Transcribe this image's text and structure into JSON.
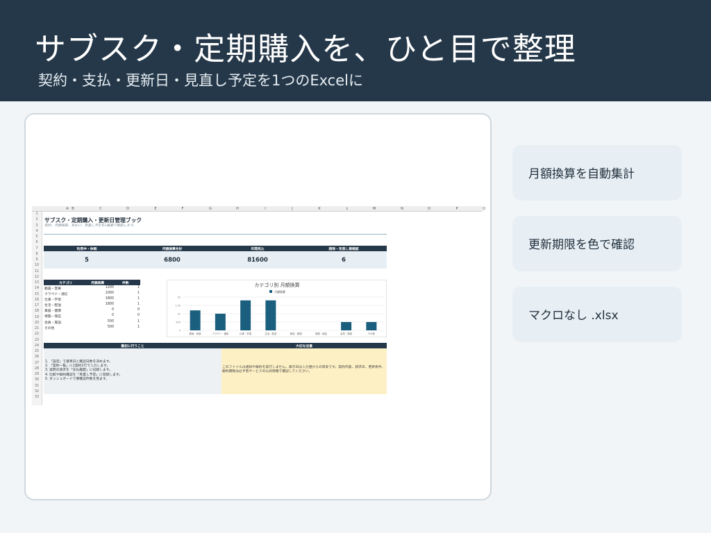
{
  "header": {
    "title": "サブスク・定期購入を、ひと目で整理",
    "subtitle": "契約・支払・更新日・見直し予定を1つのExcelに"
  },
  "sheet": {
    "columns": [
      "A",
      "B",
      "C",
      "D",
      "E",
      "F",
      "G",
      "H",
      "I",
      "J",
      "K",
      "L",
      "M",
      "N",
      "O",
      "P",
      "Q"
    ],
    "rows": [
      "1",
      "2",
      "3",
      "4",
      "5",
      "6",
      "7",
      "8",
      "9",
      "10",
      "11",
      "12",
      "13",
      "14",
      "15",
      "16",
      "17",
      "18",
      "19",
      "20",
      "21",
      "22",
      "23",
      "24",
      "25",
      "26",
      "27",
      "28",
      "29",
      "30",
      "31",
      "32",
      "33"
    ],
    "title": "サブスク・定期購入・更新日管理ブック",
    "subtitle": "契約、月額換算、支払い、見直し予定を1画面で確認します。",
    "kpis": [
      {
        "label": "利用中・休眠",
        "value": "5"
      },
      {
        "label": "月額換算合計",
        "value": "6800"
      },
      {
        "label": "年間見込",
        "value": "81600"
      },
      {
        "label": "期限・見直し要確認",
        "value": "6"
      }
    ],
    "category_table": {
      "headers": [
        "カテゴリ",
        "月額換算",
        "件数"
      ],
      "rows": [
        [
          "動画・音楽",
          "1200",
          "1"
        ],
        [
          "クラウド・通信",
          "1000",
          "1"
        ],
        [
          "仕事・学習",
          "1800",
          "1"
        ],
        [
          "生活・配送",
          "1800",
          "1"
        ],
        [
          "美容・健康",
          "0",
          "0"
        ],
        [
          "保険・保証",
          "0",
          "0"
        ],
        [
          "会員・施設",
          "500",
          "1"
        ],
        [
          "その他",
          "500",
          "1"
        ]
      ]
    },
    "steps": {
      "title": "最初に行うこと",
      "items": [
        "1. 「設定」で基準日と確認日数を決めます。",
        "2. 「契約一覧」に1契約1行で入力します。",
        "3. 実際の請求を「支払履歴」に記録します。",
        "4. 比較や解約確認を「見直し予定」に登録します。",
        "5. ダッシュボードで要確認件数を見ます。"
      ]
    },
    "notice": {
      "title": "大切な注意",
      "text": "このファイルは通知や解約を実行しません。表示日は入力値からの目安です。契約内容、請求日、更新条件、解約期限は必ず各サービスの公式情報で確認してください。"
    }
  },
  "chart_data": {
    "type": "bar",
    "title": "カテゴリ別 月額換算",
    "legend": [
      "月額換算"
    ],
    "legend_position": "top-center",
    "categories": [
      "動画・音楽",
      "クラウド・通信",
      "仕事・学習",
      "生活・配送",
      "美容・健康",
      "保険・保証",
      "会員・施設",
      "その他"
    ],
    "series": [
      {
        "name": "月額換算",
        "values": [
          1200,
          1000,
          1800,
          1800,
          0,
          0,
          500,
          500
        ]
      }
    ],
    "ylim": [
      0,
      2000
    ],
    "yticks": [
      "0",
      "500",
      "1k",
      "1.5k",
      "2k"
    ],
    "grid": true,
    "colors": {
      "bar": "#1b5f7f"
    }
  },
  "features": [
    {
      "label": "月額換算を自動集計"
    },
    {
      "label": "更新期限を色で確認"
    },
    {
      "label": "マクロなし .xlsx"
    }
  ],
  "colors": {
    "header_bg": "#253849",
    "page_bg": "#f1f5f7",
    "feature_bg": "#e7eff4",
    "notice_bg": "#fdf0c4"
  }
}
